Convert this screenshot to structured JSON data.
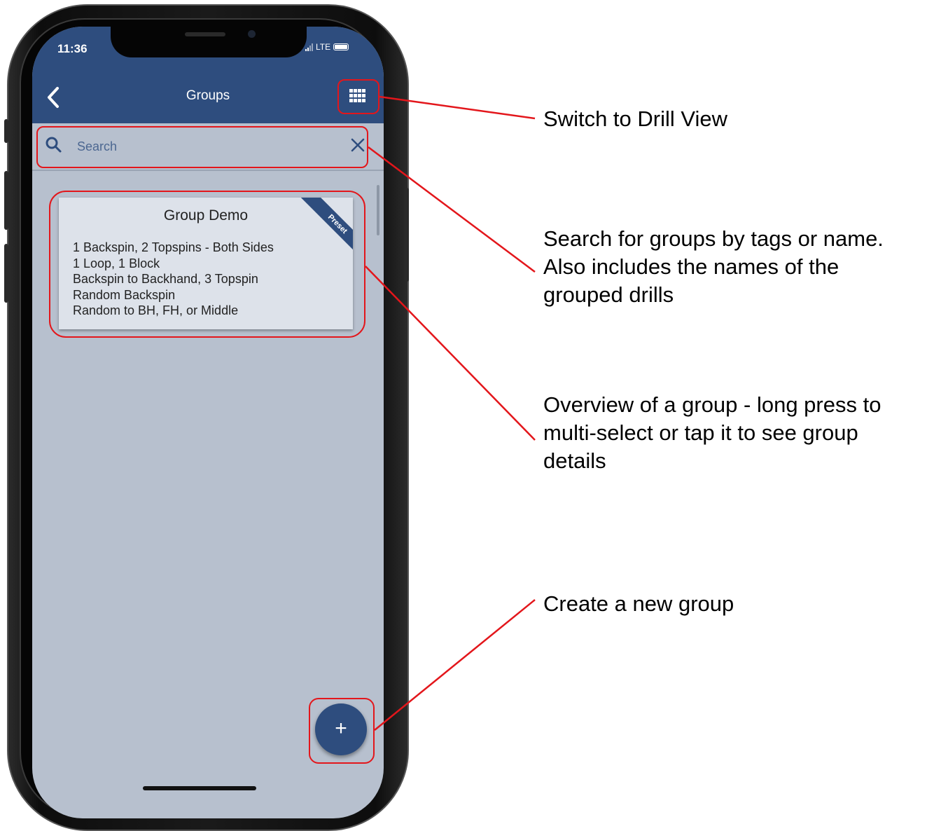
{
  "status_bar": {
    "time": "11:36",
    "network": "LTE"
  },
  "header": {
    "title": "Groups"
  },
  "search": {
    "placeholder": "Search"
  },
  "group_card": {
    "title": "Group Demo",
    "badge": "Preset",
    "drills": [
      "1 Backspin, 2 Topspins - Both Sides",
      "1 Loop, 1 Block",
      "Backspin to Backhand, 3 Topspin",
      "Random Backspin",
      "Random to BH, FH, or Middle"
    ]
  },
  "fab": {
    "label": "+"
  },
  "annotations": {
    "drill_view": "Switch to Drill View",
    "search": [
      "Search for groups by tags or name.",
      "Also includes the names of the",
      "grouped drills"
    ],
    "overview": [
      "Overview of a group - long press to",
      "multi-select or tap it to see group",
      "details"
    ],
    "create": "Create a new group"
  },
  "colors": {
    "header": "#2e4d7e",
    "screen_bg": "#b7c0ce",
    "card_bg": "#dde2ea",
    "annotation": "#e3161b"
  },
  "icons": [
    "back-chevron-icon",
    "grid-icon",
    "search-icon",
    "close-icon",
    "plus-icon",
    "signal-icon",
    "battery-icon"
  ]
}
